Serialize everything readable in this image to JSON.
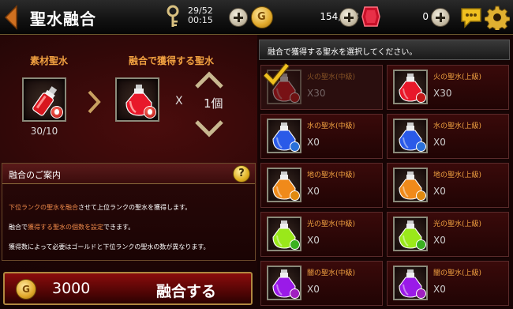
{
  "header": {
    "title": "聖水融合",
    "stamina_current": "29/52",
    "stamina_timer": "00:15",
    "gold": "154,368",
    "gems": "0"
  },
  "fusion": {
    "source_label": "素材聖水",
    "result_label": "融合で獲得する聖水",
    "source_count": "30/10",
    "multiply": "X",
    "quantity": "1個"
  },
  "guide": {
    "title": "融合のご案内",
    "help": "?",
    "line1_pre": "下位ランクの聖水を融合",
    "line1_post": "させて上位ランクの聖水を獲得します。",
    "line2_pre": "融合で",
    "line2_hl": "獲得する聖水の個数を設定",
    "line2_post": "できます。",
    "line3": "獲得数によって必要はゴールドと下位ランクの聖水の数が異なります。"
  },
  "fuse_button": {
    "cost": "3000",
    "label": "融合する"
  },
  "select_prompt": "融合で獲得する聖水を選択してください。",
  "items": [
    {
      "name": "火の聖水(中級)",
      "count": "X30",
      "color": "#d8161e",
      "badge": "#c01818",
      "selected": true
    },
    {
      "name": "火の聖水(上級)",
      "count": "X30",
      "color": "#e8182a",
      "badge": "#c01818",
      "selected": false
    },
    {
      "name": "水の聖水(中級)",
      "count": "X0",
      "color": "#2a5ae8",
      "badge": "#2a70d8",
      "selected": false
    },
    {
      "name": "水の聖水(上級)",
      "count": "X0",
      "color": "#2a5ae8",
      "badge": "#2a70d8",
      "selected": false
    },
    {
      "name": "地の聖水(中級)",
      "count": "X0",
      "color": "#f08a1a",
      "badge": "#e08a10",
      "selected": false
    },
    {
      "name": "地の聖水(上級)",
      "count": "X0",
      "color": "#f08a1a",
      "badge": "#e08a10",
      "selected": false
    },
    {
      "name": "光の聖水(中級)",
      "count": "X0",
      "color": "#9ae81a",
      "badge": "#3ab020",
      "selected": false
    },
    {
      "name": "光の聖水(上級)",
      "count": "X0",
      "color": "#9ae81a",
      "badge": "#3ab020",
      "selected": false
    },
    {
      "name": "闇の聖水(中級)",
      "count": "X0",
      "color": "#9a1ae8",
      "badge": "#a020c0",
      "selected": false
    },
    {
      "name": "闇の聖水(上級)",
      "count": "X0",
      "color": "#9a1ae8",
      "badge": "#a020c0",
      "selected": false
    }
  ]
}
